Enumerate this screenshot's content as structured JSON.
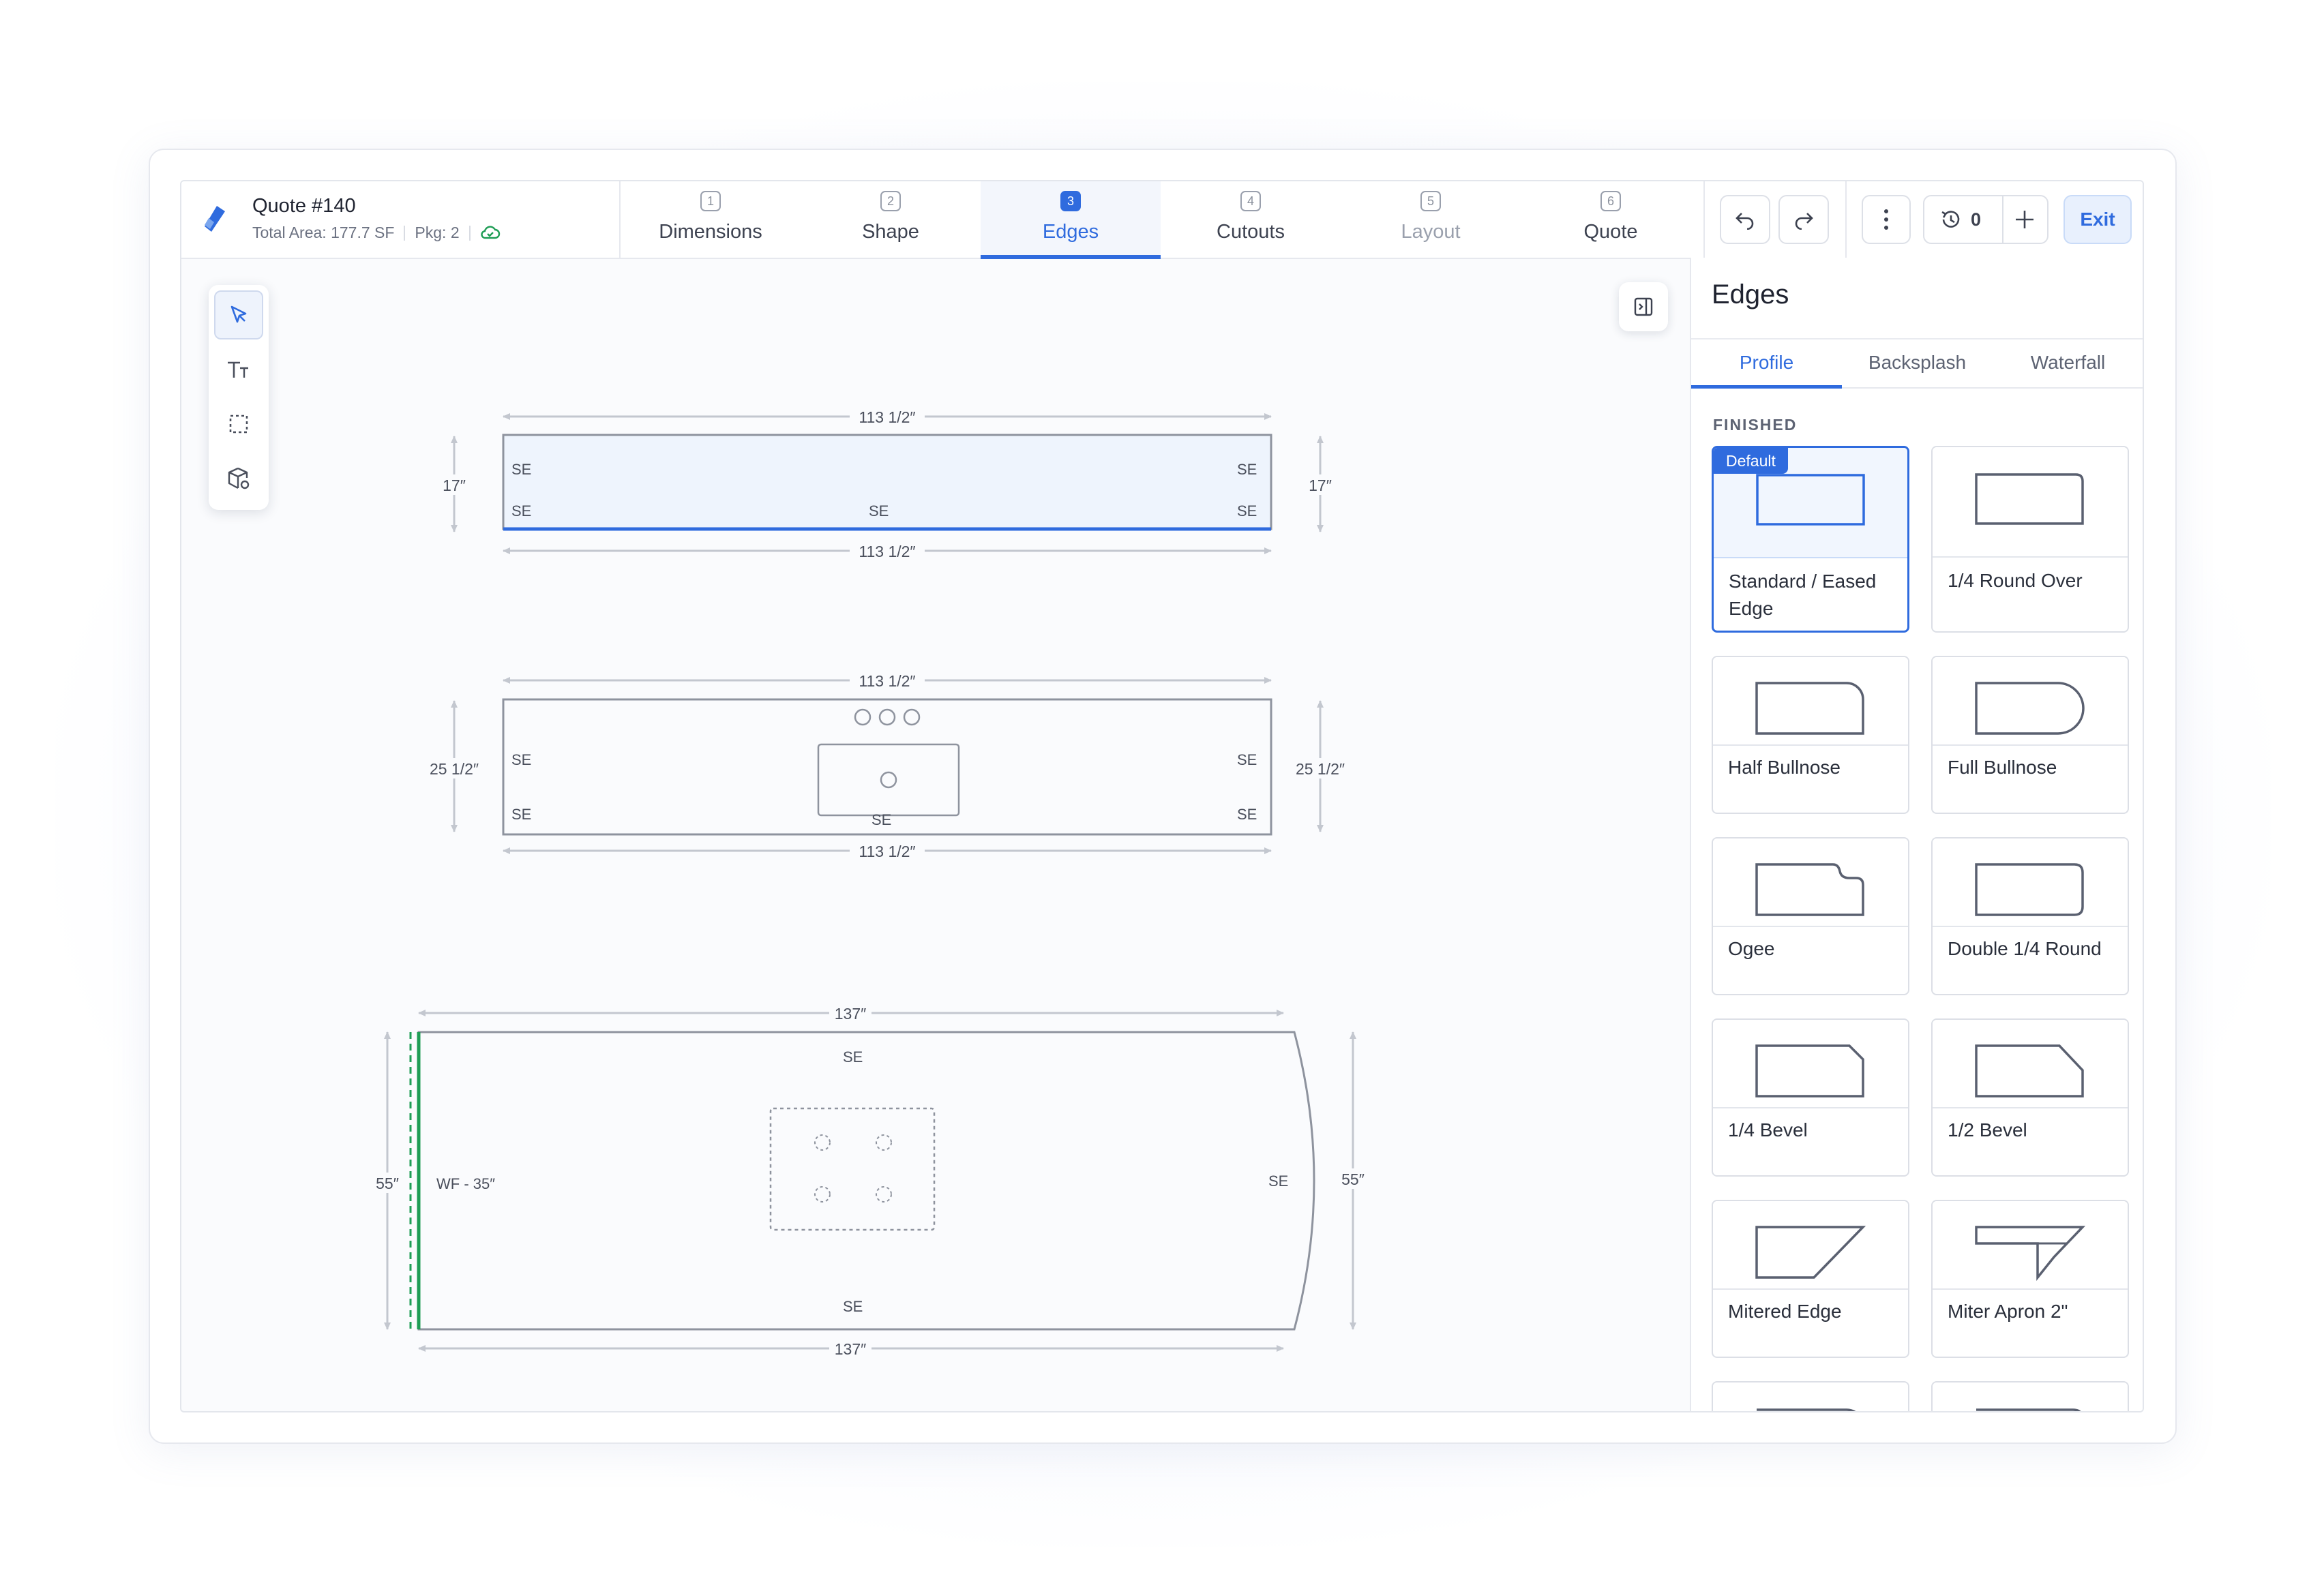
{
  "header": {
    "quote_title": "Quote #140",
    "total_area": "Total Area: 177.7 SF",
    "pkg": "Pkg: 2",
    "steps": [
      {
        "num": "1",
        "label": "Dimensions"
      },
      {
        "num": "2",
        "label": "Shape"
      },
      {
        "num": "3",
        "label": "Edges"
      },
      {
        "num": "4",
        "label": "Cutouts"
      },
      {
        "num": "5",
        "label": "Layout"
      },
      {
        "num": "6",
        "label": "Quote"
      }
    ],
    "active_step": "Edges",
    "history_count": "0",
    "exit_label": "Exit"
  },
  "toolbar": {
    "tools": [
      "select-tool",
      "text-tool",
      "marquee-tool",
      "material-tool"
    ]
  },
  "canvas": {
    "piece1": {
      "top_dim": "113 1/2″",
      "bottom_dim": "113 1/2″",
      "left_dim": "17″",
      "right_dim": "17″",
      "edges": {
        "tl": "SE",
        "tr": "SE",
        "bl": "SE",
        "bc": "SE",
        "br": "SE"
      }
    },
    "piece2": {
      "top_dim": "113 1/2″",
      "bottom_dim": "113 1/2″",
      "left_dim": "25 1/2″",
      "right_dim": "25 1/2″",
      "edges": {
        "tl": "SE",
        "tr": "SE",
        "bl": "SE",
        "bc": "SE",
        "br": "SE"
      }
    },
    "piece3": {
      "top_dim": "137″",
      "bottom_dim": "137″",
      "left_dim": "55″",
      "right_dim": "55″",
      "edges": {
        "top": "SE",
        "bottom": "SE",
        "right": "SE",
        "left": "WF - 35″"
      }
    }
  },
  "panel": {
    "title": "Edges",
    "tabs": [
      "Profile",
      "Backsplash",
      "Waterfall"
    ],
    "active_tab": "Profile",
    "section": "FINISHED",
    "default_badge": "Default",
    "profiles": [
      {
        "name": "Standard / Eased Edge",
        "selected": true
      },
      {
        "name": "1/4 Round Over"
      },
      {
        "name": "Half Bullnose"
      },
      {
        "name": "Full Bullnose"
      },
      {
        "name": "Ogee"
      },
      {
        "name": "Double 1/4 Round"
      },
      {
        "name": "1/4 Bevel"
      },
      {
        "name": "1/2 Bevel"
      },
      {
        "name": "Mitered Edge"
      },
      {
        "name": "Miter Apron 2\""
      }
    ]
  },
  "colors": {
    "accent": "#2f6bde",
    "waterfall_edge": "#1f9d55",
    "selected_fill": "#eef4fd",
    "outline": "#8e939e"
  }
}
